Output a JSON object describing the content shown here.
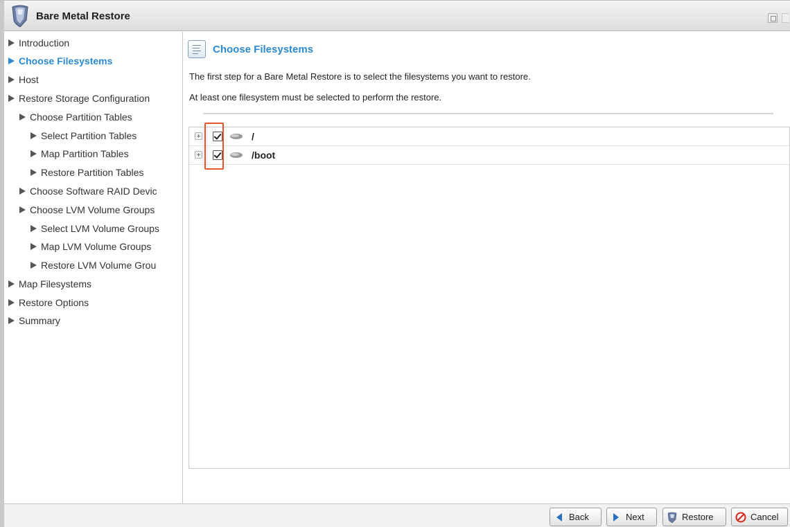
{
  "window": {
    "title": "Bare Metal Restore"
  },
  "sidebar": {
    "items": [
      {
        "label": "Introduction",
        "active": false
      },
      {
        "label": "Choose Filesystems",
        "active": true
      },
      {
        "label": "Host",
        "active": false
      },
      {
        "label": "Restore Storage Configuration",
        "active": false
      },
      {
        "label": "Choose Partition Tables",
        "active": false
      },
      {
        "label": "Select Partition Tables",
        "active": false
      },
      {
        "label": "Map Partition Tables",
        "active": false
      },
      {
        "label": "Restore Partition Tables",
        "active": false
      },
      {
        "label": "Choose Software RAID Devic",
        "active": false
      },
      {
        "label": "Choose LVM Volume Groups",
        "active": false
      },
      {
        "label": "Select LVM Volume Groups",
        "active": false
      },
      {
        "label": "Map LVM Volume Groups",
        "active": false
      },
      {
        "label": "Restore LVM Volume Grou",
        "active": false
      },
      {
        "label": "Map Filesystems",
        "active": false
      },
      {
        "label": "Restore Options",
        "active": false
      },
      {
        "label": "Summary",
        "active": false
      }
    ]
  },
  "main": {
    "title": "Choose Filesystems",
    "description_1": "The first step for a Bare Metal Restore is to select the filesystems you want to restore.",
    "description_2": "At least one filesystem must be selected to perform the restore.",
    "filesystems": [
      {
        "name": "/",
        "checked": true
      },
      {
        "name": "/boot",
        "checked": true
      }
    ]
  },
  "footer": {
    "back_label": "Back",
    "next_label": "Next",
    "restore_label": "Restore",
    "cancel_label": "Cancel"
  },
  "colors": {
    "accent": "#2a8ad8",
    "highlight": "#e8542a",
    "cancel_red": "#d9261c"
  }
}
